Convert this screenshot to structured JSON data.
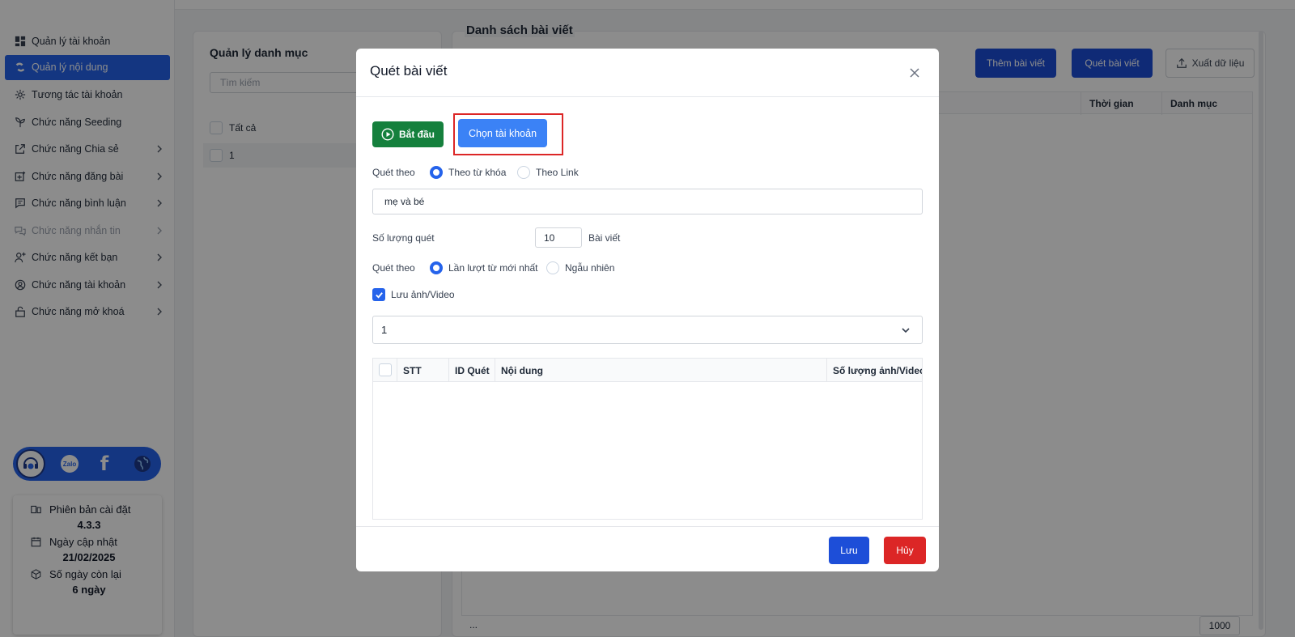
{
  "sidebar": {
    "items": [
      {
        "label": "Quản lý tài khoản",
        "icon": "dashboard-icon",
        "chevron": false,
        "state": "normal"
      },
      {
        "label": "Quản lý nội dung",
        "icon": "content-icon",
        "chevron": false,
        "state": "active"
      },
      {
        "label": "Tương tác tài khoản",
        "icon": "interaction-icon",
        "chevron": false,
        "state": "normal"
      },
      {
        "label": "Chức năng Seeding",
        "icon": "seeding-icon",
        "chevron": false,
        "state": "normal"
      },
      {
        "label": "Chức năng Chia sẻ",
        "icon": "share-icon",
        "chevron": true,
        "state": "normal"
      },
      {
        "label": "Chức năng đăng bài",
        "icon": "post-icon",
        "chevron": true,
        "state": "normal"
      },
      {
        "label": "Chức năng bình luận",
        "icon": "comment-icon",
        "chevron": true,
        "state": "normal"
      },
      {
        "label": "Chức năng nhắn tin",
        "icon": "message-icon",
        "chevron": true,
        "state": "disabled"
      },
      {
        "label": "Chức năng kết bạn",
        "icon": "add-friend-icon",
        "chevron": true,
        "state": "normal"
      },
      {
        "label": "Chức năng tài khoản",
        "icon": "user-circle-icon",
        "chevron": true,
        "state": "normal"
      },
      {
        "label": "Chức năng mở khoá",
        "icon": "unlock-icon",
        "chevron": true,
        "state": "normal"
      }
    ],
    "social": {
      "zalo": "Zalo",
      "facebook": "f"
    },
    "info": {
      "version_label": "Phiên bản cài đặt",
      "version_value": "4.3.3",
      "update_label": "Ngày cập nhật",
      "update_value": "21/02/2025",
      "remaining_label": "Số ngày còn lại",
      "remaining_value": "6 ngày"
    }
  },
  "category": {
    "title": "Quản lý danh mục",
    "search_placeholder": "Tìm kiếm",
    "rows": [
      "Tất cả",
      "1"
    ]
  },
  "list": {
    "title": "Danh sách bài viết",
    "add_button": "Thêm bài viết",
    "scan_button": "Quét bài viết",
    "export_button": "Xuất dữ liệu",
    "columns": [
      "Thời gian",
      "Danh mục"
    ],
    "pager_dots": "...",
    "page_size": "1000"
  },
  "modal": {
    "title": "Quét bài viết",
    "start_button": "Bắt đầu",
    "choose_account_button": "Chọn tài khoản",
    "scan_by_label": "Quét theo",
    "scan_by_options": [
      "Theo từ khóa",
      "Theo Link"
    ],
    "keyword_value": "mẹ và bé",
    "count_label": "Số lượng quét",
    "count_value": "10",
    "count_unit": "Bài viết",
    "order_label": "Quét theo",
    "order_options": [
      "Lần lượt từ mới nhất",
      "Ngẫu nhiên"
    ],
    "save_media_label": "Lưu ảnh/Video",
    "save_media_checked": true,
    "category_select_value": "1",
    "table_columns": [
      "STT",
      "ID Quét",
      "Nội dung",
      "Số lượng ảnh/Video"
    ],
    "save_button": "Lưu",
    "cancel_button": "Hủy"
  },
  "colors": {
    "primary": "#2563eb",
    "start_green": "#15803d",
    "danger_red": "#dc2626",
    "highlight": "#dc2626"
  }
}
